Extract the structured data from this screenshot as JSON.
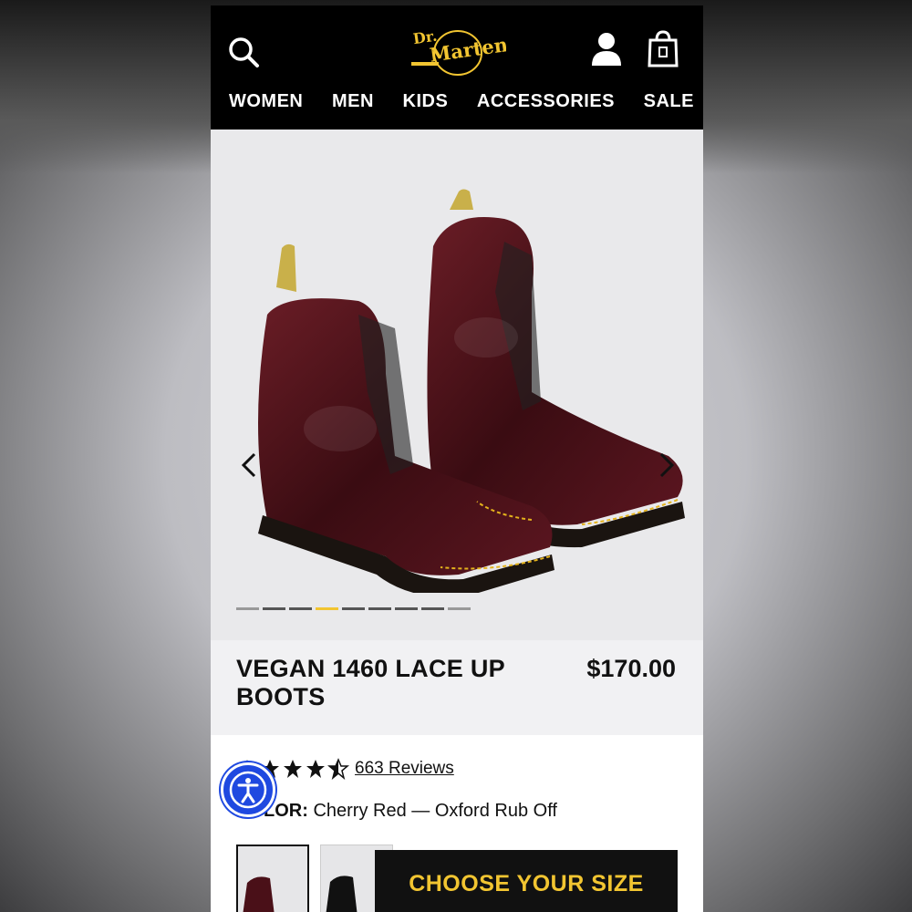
{
  "brand": {
    "logo_text": "Dr. Martens"
  },
  "nav": {
    "items": [
      "WOMEN",
      "MEN",
      "KIDS",
      "ACCESSORIES",
      "SALE"
    ]
  },
  "product": {
    "title": "VEGAN 1460 LACE UP BOOTS",
    "price": "$170.00",
    "rating": 4.5,
    "reviews_label": "663 Reviews",
    "color_label": "COLOR:",
    "color_value": "Cherry Red — Oxford Rub Off",
    "cta_label": "CHOOSE YOUR SIZE"
  },
  "carousel": {
    "total": 9,
    "active_index": 3
  },
  "colors": {
    "accent": "#f2c531",
    "header": "#000000",
    "a11y_button": "#1f49e0"
  },
  "icons": [
    "search-icon",
    "user-icon",
    "shopping-bag-icon",
    "chevron-left-icon",
    "chevron-right-icon",
    "star-icon",
    "accessibility-icon"
  ]
}
